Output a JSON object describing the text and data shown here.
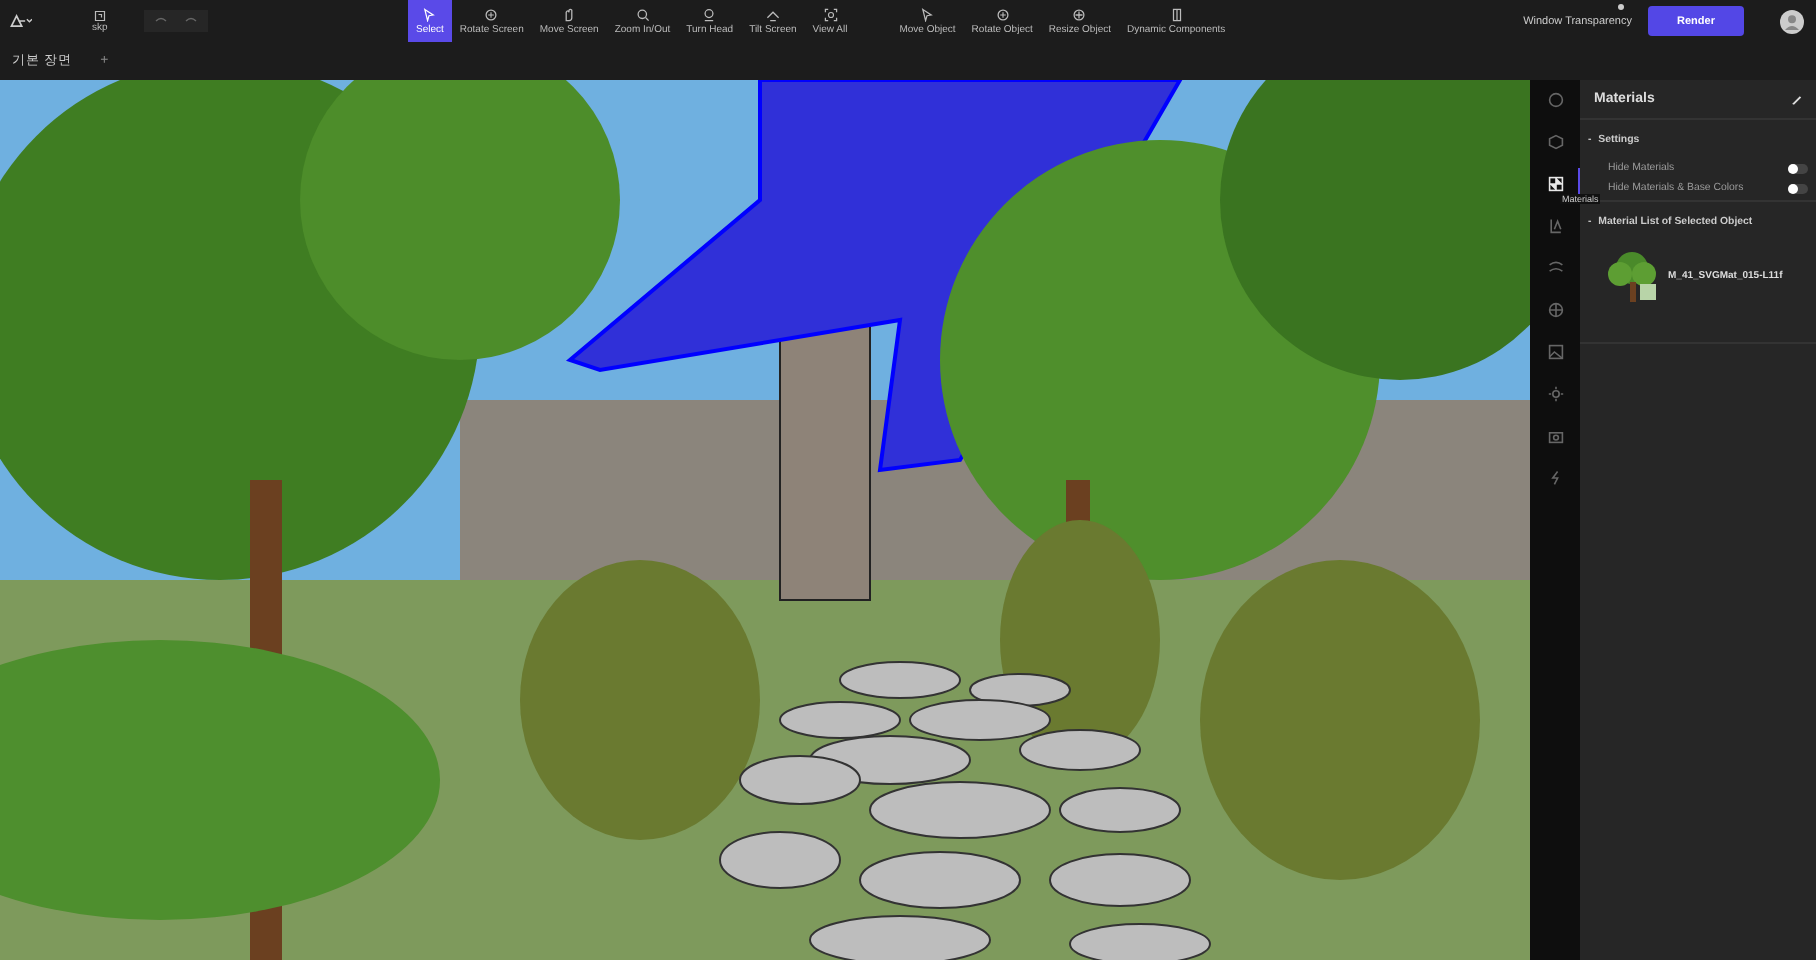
{
  "file_button": {
    "label": "skp"
  },
  "toolbar": [
    {
      "label": "Select",
      "selected": true
    },
    {
      "label": "Rotate Screen",
      "selected": false
    },
    {
      "label": "Move Screen",
      "selected": false
    },
    {
      "label": "Zoom In/Out",
      "selected": false
    },
    {
      "label": "Turn Head",
      "selected": false
    },
    {
      "label": "Tilt Screen",
      "selected": false
    },
    {
      "label": "View All",
      "selected": false
    },
    {
      "label": "Move Object",
      "selected": false
    },
    {
      "label": "Rotate Object",
      "selected": false
    },
    {
      "label": "Resize Object",
      "selected": false
    },
    {
      "label": "Dynamic Components",
      "selected": false
    }
  ],
  "window_transparency": {
    "label": "Window Transparency"
  },
  "render_button": {
    "label": "Render"
  },
  "scene_tabs": [
    {
      "label": "기본 장면",
      "selected": true
    }
  ],
  "add_tab": {
    "label": "+"
  },
  "rail": [
    {
      "selected": false
    },
    {
      "selected": false
    },
    {
      "selected": true,
      "tooltip": "Materials"
    },
    {
      "selected": false
    },
    {
      "selected": false
    },
    {
      "selected": false
    },
    {
      "selected": false
    },
    {
      "selected": false
    },
    {
      "selected": false
    },
    {
      "selected": false
    }
  ],
  "panel": {
    "title": "Materials",
    "sections": [
      {
        "toggle": "-",
        "title": "Settings",
        "expanded": true,
        "kind": "settings",
        "options": [
          {
            "label": "Hide Materials",
            "on": false
          },
          {
            "label": "Hide Materials & Base Colors",
            "on": false
          }
        ]
      },
      {
        "toggle": "-",
        "title": "Material List of Selected Object",
        "expanded": true,
        "kind": "materials",
        "items": [
          {
            "name": "M_41_SVGMat_015-L11f"
          }
        ]
      }
    ]
  }
}
